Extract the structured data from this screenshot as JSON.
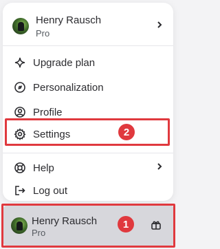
{
  "menu": {
    "account": {
      "name": "Henry Rausch",
      "plan": "Pro"
    },
    "items": [
      {
        "label": "Upgrade plan",
        "icon": "sparkle-icon"
      },
      {
        "label": "Personalization",
        "icon": "personalization-icon"
      },
      {
        "label": "Profile",
        "icon": "profile-icon"
      },
      {
        "label": "Settings",
        "icon": "gear-icon"
      },
      {
        "label": "Help",
        "icon": "lifebuoy-icon"
      },
      {
        "label": "Log out",
        "icon": "logout-icon"
      }
    ]
  },
  "footer": {
    "name": "Henry Rausch",
    "plan": "Pro",
    "icon": "gift-icon"
  },
  "annotations": {
    "settings_badge": "2",
    "footer_badge": "1",
    "color": "#e0393e"
  }
}
